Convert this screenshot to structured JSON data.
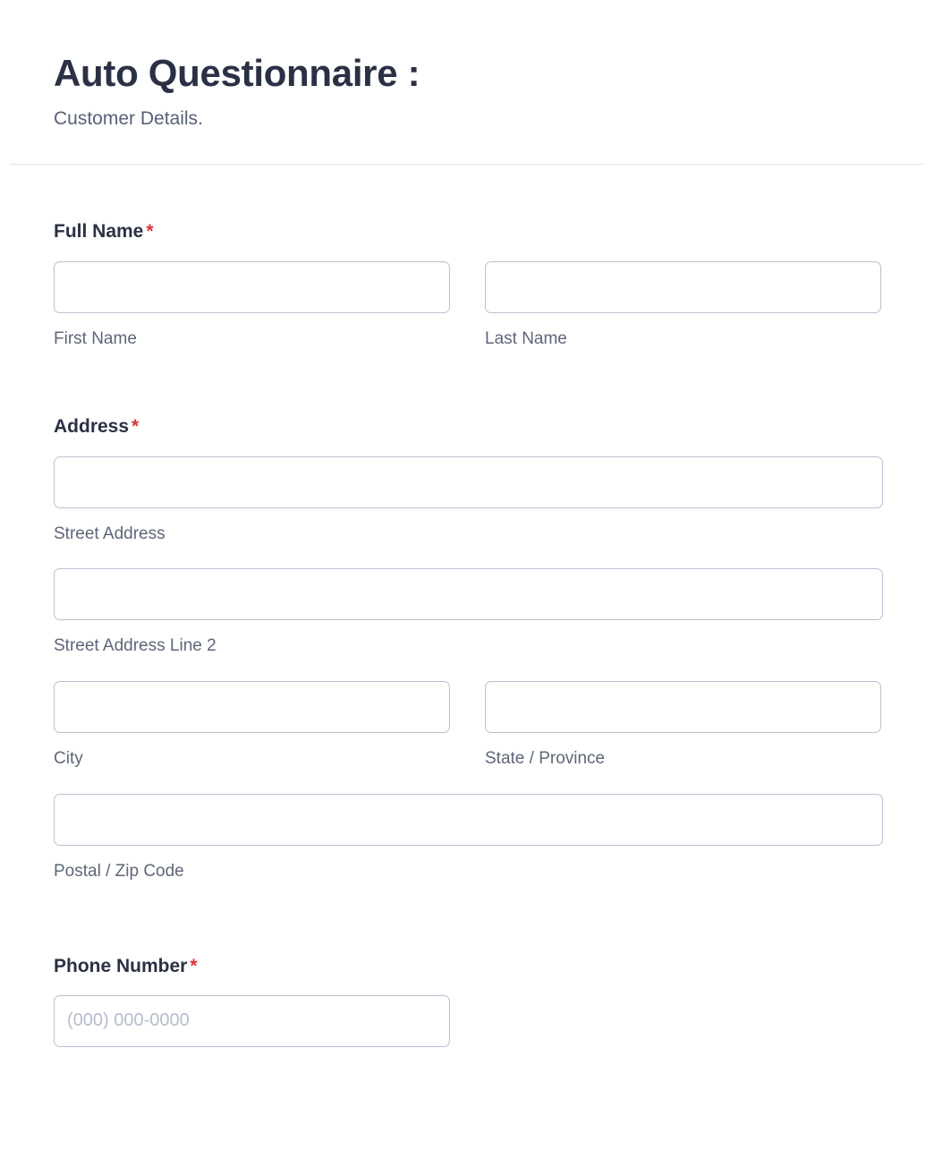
{
  "header": {
    "title": "Auto Questionnaire :",
    "subtitle": "Customer Details."
  },
  "theme": {
    "label_color": "#2b3144",
    "sublabel_color": "#5d6679",
    "required_color": "#d8353c",
    "input_border": "#b9c0d1",
    "divider": "#e3e5ea",
    "background": "#ffffff",
    "placeholder_color": "#b5bccd"
  },
  "required_marker": "*",
  "fields": {
    "full_name": {
      "label": "Full Name",
      "required": true,
      "first": {
        "sublabel": "First Name",
        "value": "",
        "placeholder": ""
      },
      "last": {
        "sublabel": "Last Name",
        "value": "",
        "placeholder": ""
      }
    },
    "address": {
      "label": "Address",
      "required": true,
      "street": {
        "sublabel": "Street Address",
        "value": "",
        "placeholder": ""
      },
      "street2": {
        "sublabel": "Street Address Line 2",
        "value": "",
        "placeholder": ""
      },
      "city": {
        "sublabel": "City",
        "value": "",
        "placeholder": ""
      },
      "state": {
        "sublabel": "State / Province",
        "value": "",
        "placeholder": ""
      },
      "postal": {
        "sublabel": "Postal / Zip Code",
        "value": "",
        "placeholder": ""
      }
    },
    "phone": {
      "label": "Phone Number",
      "required": true,
      "input": {
        "value": "",
        "placeholder": "(000) 000-0000"
      }
    }
  }
}
